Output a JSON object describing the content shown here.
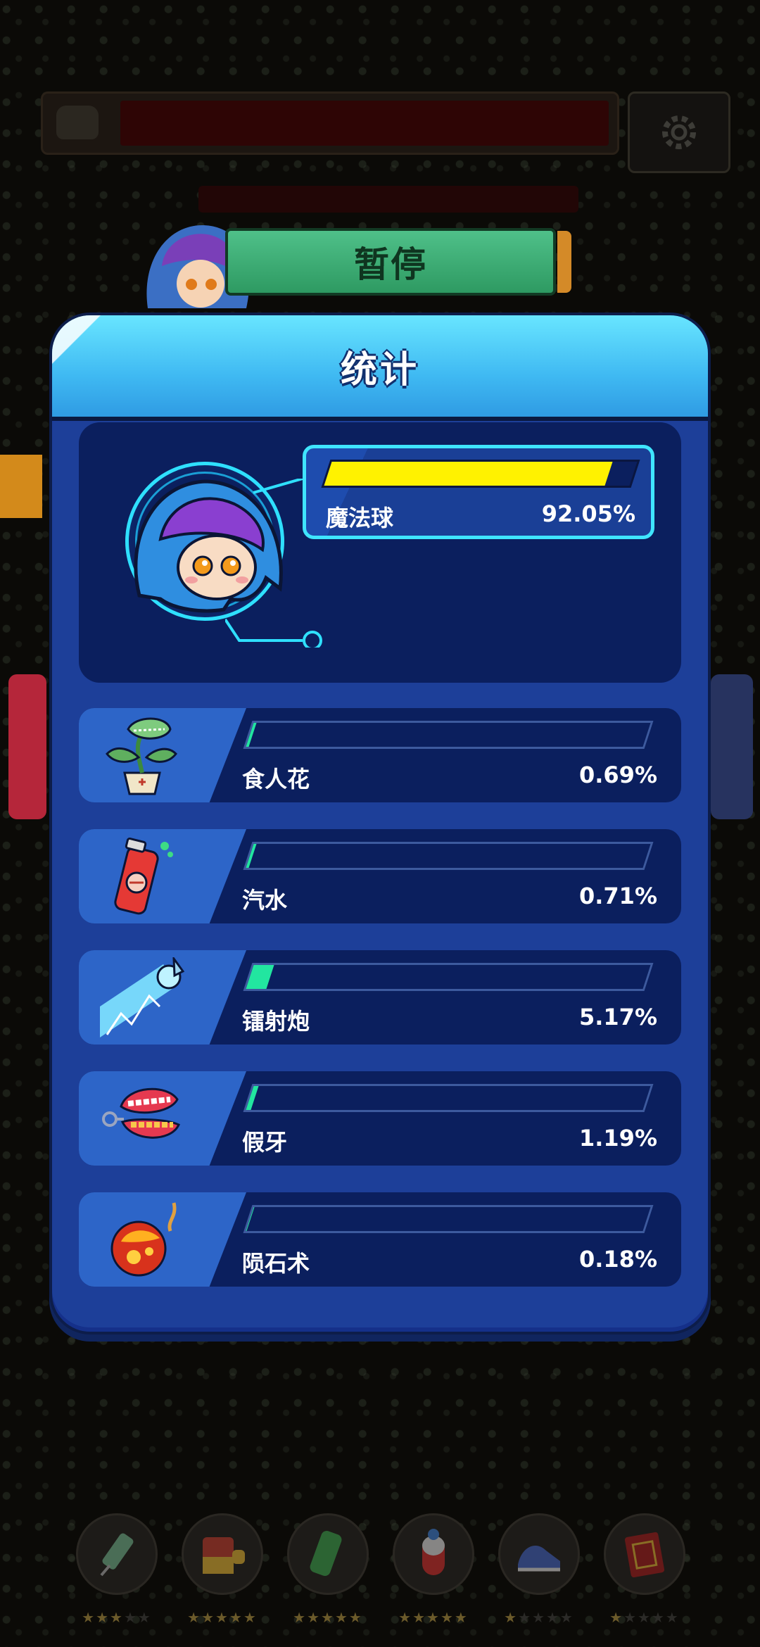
{
  "header": {
    "pause_label": "暂停"
  },
  "panel": {
    "title": "统计"
  },
  "main_weapon": {
    "name": "魔法球",
    "percent_text": "92.05%",
    "share": 0.9205,
    "bar_color": "#fff200"
  },
  "weapons": [
    {
      "name": "食人花",
      "percent_text": "0.69%",
      "share": 0.0069,
      "icon": "carnivorous-plant-icon"
    },
    {
      "name": "汽水",
      "percent_text": "0.71%",
      "share": 0.0071,
      "icon": "soda-can-icon"
    },
    {
      "name": "镭射炮",
      "percent_text": "5.17%",
      "share": 0.0517,
      "icon": "laser-cannon-icon"
    },
    {
      "name": "假牙",
      "percent_text": "1.19%",
      "share": 0.0119,
      "icon": "false-teeth-icon"
    },
    {
      "name": "陨石术",
      "percent_text": "0.18%",
      "share": 0.0018,
      "icon": "meteor-icon"
    }
  ],
  "equipment_slots": [
    {
      "icon": "syringe-icon",
      "stars": 3,
      "max_stars": 5
    },
    {
      "icon": "battery-icon",
      "stars": 5,
      "max_stars": 5
    },
    {
      "icon": "green-canister-icon",
      "stars": 5,
      "max_stars": 5
    },
    {
      "icon": "pill-capsule-icon",
      "stars": 5,
      "max_stars": 5
    },
    {
      "icon": "sneaker-icon",
      "stars": 1,
      "max_stars": 5
    },
    {
      "icon": "kungfu-book-icon",
      "stars": 1,
      "max_stars": 5
    }
  ],
  "colors": {
    "accent_cyan": "#3fe5ff",
    "bar_green": "#22e6a0",
    "panel_blue": "#1d3f99"
  }
}
